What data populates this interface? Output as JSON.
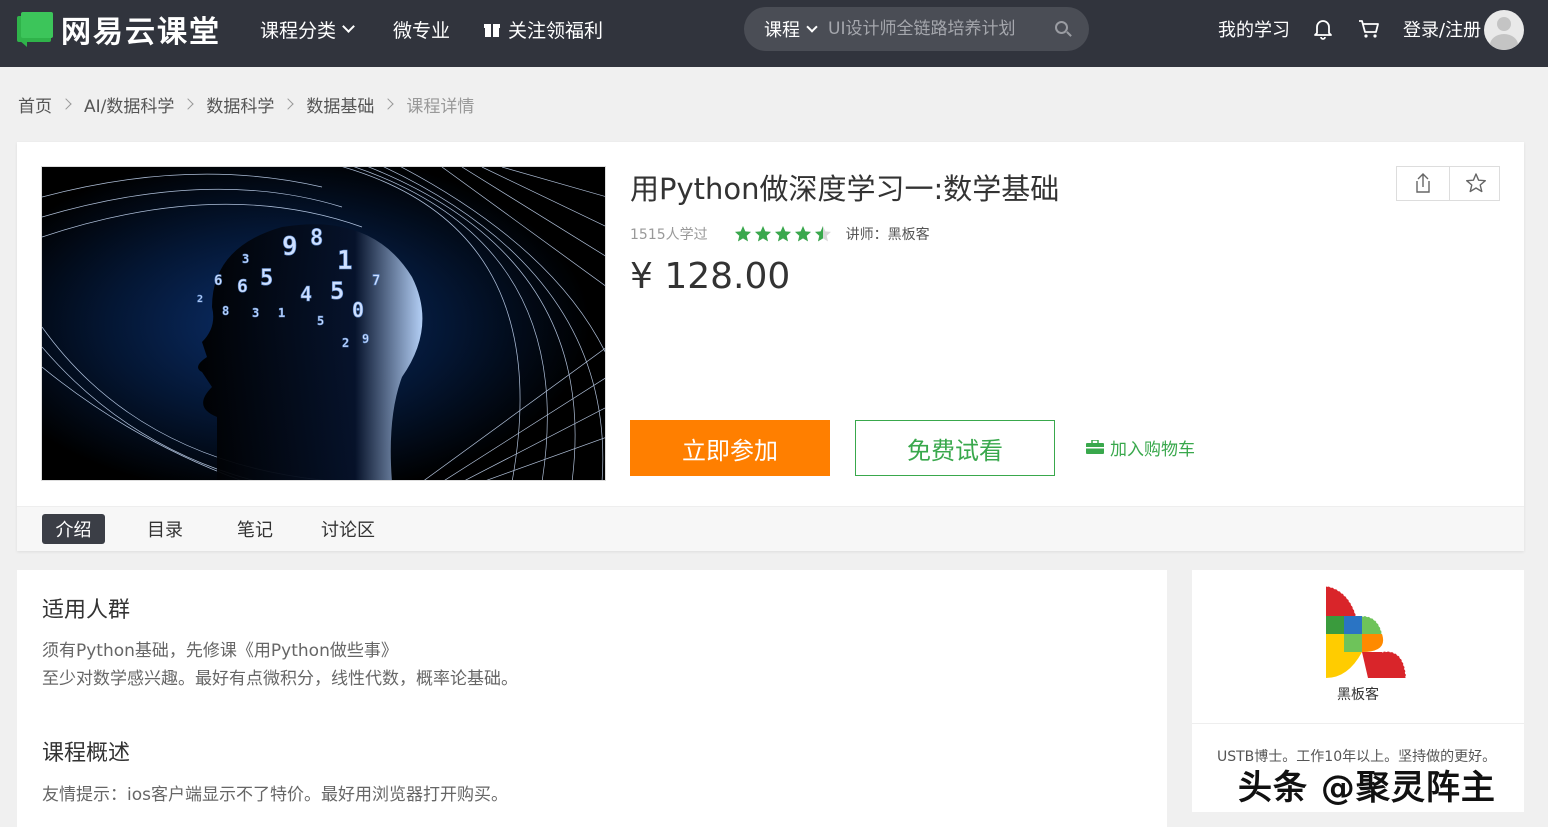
{
  "brand": {
    "name": "网易云课堂",
    "accent": "#2fb34a"
  },
  "nav": {
    "category": "课程分类",
    "micro": "微专业",
    "gift": "关注领福利",
    "my_learning": "我的学习",
    "login": "登录/注册"
  },
  "search": {
    "type": "课程",
    "placeholder": "UI设计师全链路培养计划"
  },
  "breadcrumb": [
    "首页",
    "AI/数据科学",
    "数据科学",
    "数据基础",
    "课程详情"
  ],
  "course": {
    "title": "用Python做深度学习一:数学基础",
    "learners": "1515人学过",
    "rating": 4.5,
    "teacher_label": "讲师：黑板客",
    "price": "¥ 128.00",
    "join_label": "立即参加",
    "trial_label": "免费试看",
    "cart_label": "加入购物车",
    "orange": "#ff7f00",
    "green": "#39a84c"
  },
  "tabs": [
    "介绍",
    "目录",
    "笔记",
    "讨论区"
  ],
  "intro": {
    "audience_title": "适用人群",
    "audience_lines": [
      "须有Python基础，先修课《用Python做些事》",
      "至少对数学感兴趣。最好有点微积分，线性代数，概率论基础。"
    ],
    "overview_title": "课程概述",
    "overview_lines": [
      "友情提示：ios客户端显示不了特价。最好用浏览器打开购买。"
    ]
  },
  "teacher": {
    "name": "黑板客",
    "bio": "USTB博士。工作10年以上。坚持做的更好。"
  },
  "watermark": "头条 @聚灵阵主"
}
